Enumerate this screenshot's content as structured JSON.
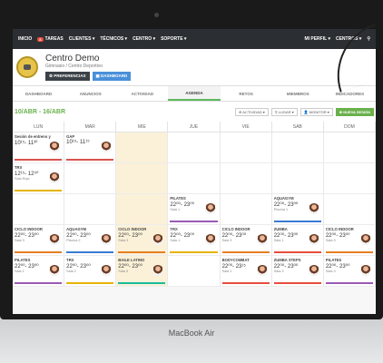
{
  "topnav": {
    "items": [
      "INICIO",
      "TAREAS",
      "CLIENTES ▾",
      "TÉCNICOS ▾",
      "CENTRO ▾",
      "SOPORTE ▾"
    ],
    "tasks_badge": "8",
    "right": [
      "MI PERFIL ▾",
      "CENTROS ▾"
    ]
  },
  "header": {
    "title": "Centro Demo",
    "subtitle": "Gimnasio / Centro Deportivo",
    "pref_label": "⚙ PREFERENCIAS",
    "dash_label": "▦ DASHBOARD"
  },
  "tabs": [
    "DASHBOARD",
    "ANUNCIOS",
    "ACTIVIDAD",
    "AGENDA",
    "RETOS",
    "MIEMBROS",
    "INDICADORES"
  ],
  "toolbar": {
    "range": "10/ABR - 16/ABR",
    "activity": "⊕ ACTIVIDAD ▾",
    "place": "⚲ LUGAR ▾",
    "monitor": "👤 MONITOR ▾",
    "new": "⊕ NUEVA SESIÓN"
  },
  "days": [
    "LUN",
    "MAR",
    "MIE",
    "JUE",
    "VIE",
    "SAB",
    "DOM"
  ],
  "events": [
    {
      "row": 0,
      "col": 0,
      "title": "Sesión de entreno y",
      "time": "10¹⁵- 11³⁰",
      "room": "",
      "color": "#d9534f",
      "avatar": true
    },
    {
      "row": 0,
      "col": 1,
      "title": "GAP",
      "time": "10¹⁵- 11¹⁵",
      "room": "",
      "color": "#d9534f",
      "avatar": true
    },
    {
      "row": 1,
      "col": 0,
      "title": "TRX",
      "time": "12¹⁵- 12⁵⁰",
      "room": "Sala Roja",
      "color": "#e6b400",
      "avatar": true
    },
    {
      "row": 2,
      "col": 3,
      "title": "PILATES",
      "time": "22⁰⁰- 23⁰⁰",
      "room": "Sala 1",
      "color": "#9b59b6",
      "avatar": true
    },
    {
      "row": 2,
      "col": 5,
      "title": "AQUAGYM",
      "time": "22⁰⁰- 23⁰⁰",
      "room": "Piscina 1",
      "color": "#3a7bd5",
      "avatar": true
    },
    {
      "row": 3,
      "col": 0,
      "title": "CICLO INDOOR",
      "time": "22⁰⁰- 23⁰⁰",
      "room": "Sala 3",
      "color": "#e67e22",
      "avatar": true
    },
    {
      "row": 3,
      "col": 1,
      "title": "AQUAGYM",
      "time": "22⁰⁰- 23⁰⁰",
      "room": "Piscina 2",
      "color": "#3a7bd5",
      "avatar": true
    },
    {
      "row": 3,
      "col": 2,
      "title": "CICLO INDOOR",
      "time": "22⁰⁰- 23⁰⁰",
      "room": "Sala 3",
      "color": "#e67e22",
      "avatar": true
    },
    {
      "row": 3,
      "col": 3,
      "title": "TRX",
      "time": "22⁰⁰- 23⁰⁰",
      "room": "Sala 1",
      "color": "#e6b400",
      "avatar": true
    },
    {
      "row": 3,
      "col": 4,
      "title": "CICLO INDOOR",
      "time": "22⁰⁰- 23⁰⁰",
      "room": "Sala 3",
      "color": "#e67e22",
      "avatar": true
    },
    {
      "row": 3,
      "col": 5,
      "title": "ZUMBA",
      "time": "22⁰⁰- 23⁰⁰",
      "room": "Sala 1",
      "color": "#e74c3c",
      "avatar": true
    },
    {
      "row": 3,
      "col": 6,
      "title": "CICLO INDOOR",
      "time": "22⁰⁰- 23⁰⁰",
      "room": "Sala 3",
      "color": "#e67e22",
      "avatar": true
    },
    {
      "row": 4,
      "col": 0,
      "title": "PILATES",
      "time": "22⁰⁰- 23⁰⁰",
      "room": "Sala 1",
      "color": "#9b59b6",
      "avatar": true
    },
    {
      "row": 4,
      "col": 1,
      "title": "TRX",
      "time": "22⁰⁰- 23⁰⁰",
      "room": "Sala 2",
      "color": "#e6b400",
      "avatar": true
    },
    {
      "row": 4,
      "col": 2,
      "title": "BAILE LATINO",
      "time": "22⁰⁰- 23⁰⁰",
      "room": "Sala 3",
      "color": "#1abc9c",
      "avatar": true
    },
    {
      "row": 4,
      "col": 4,
      "title": "BODYCOMBAT",
      "time": "22⁰⁰- 23¹⁵",
      "room": "Sala 1",
      "color": "#e74c3c",
      "avatar": true
    },
    {
      "row": 4,
      "col": 5,
      "title": "ZUMBA STEPS",
      "time": "22⁰⁰- 23⁰⁰",
      "room": "Sala 3",
      "color": "#e74c3c",
      "avatar": true
    },
    {
      "row": 4,
      "col": 6,
      "title": "PILATES",
      "time": "22⁰⁰- 23⁰⁰",
      "room": "Sala 3",
      "color": "#9b59b6",
      "avatar": true
    }
  ],
  "laptop": {
    "brand": "MacBook Air"
  }
}
